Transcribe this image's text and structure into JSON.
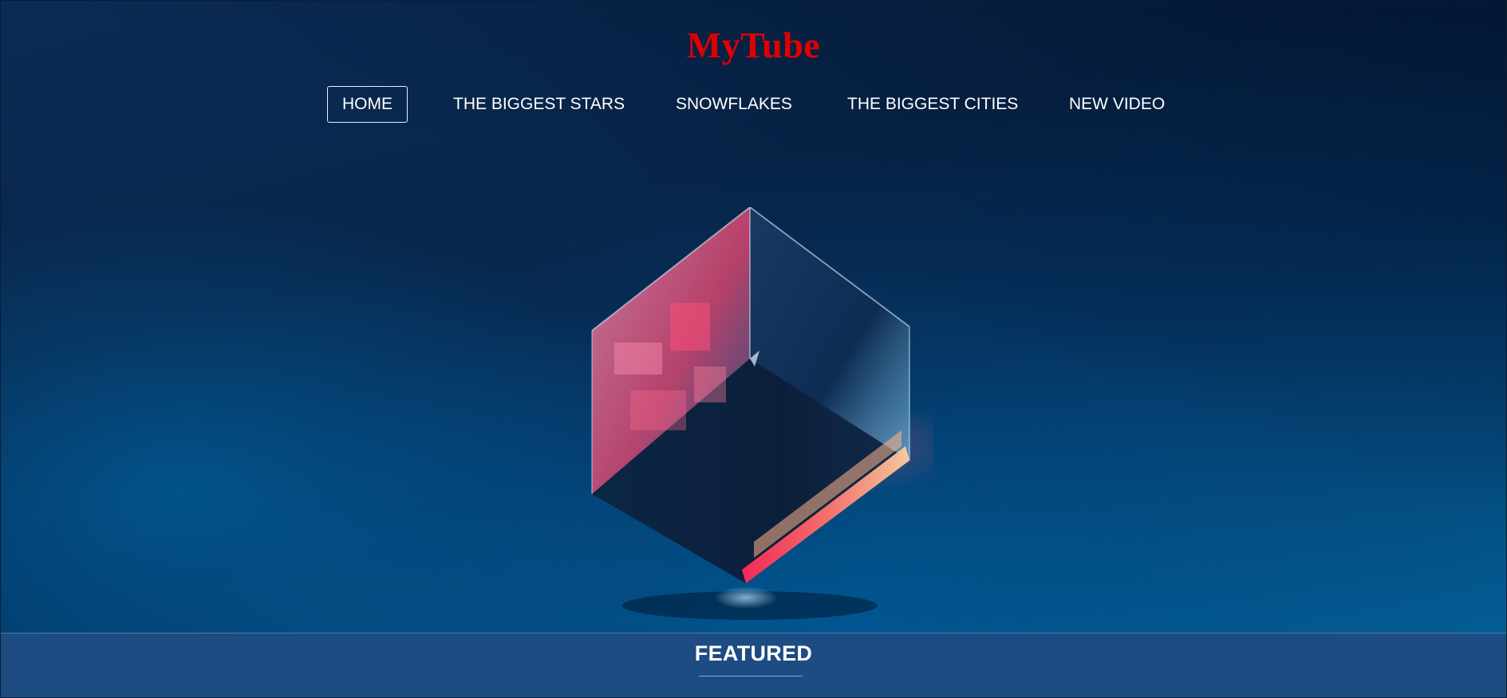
{
  "brand": {
    "name": "MyTube"
  },
  "nav": {
    "items": [
      {
        "label": "HOME",
        "active": true
      },
      {
        "label": "THE BIGGEST STARS",
        "active": false
      },
      {
        "label": "SNOWFLAKES",
        "active": false
      },
      {
        "label": "THE BIGGEST CITIES",
        "active": false
      },
      {
        "label": "NEW VIDEO",
        "active": false
      }
    ]
  },
  "hero": {
    "image": "glass-cube-illustration"
  },
  "featured": {
    "title": "FEATURED"
  },
  "colors": {
    "brand": "#e00000",
    "featured_bar": "#1c4c82",
    "hero_dark": "#08264b",
    "hero_light": "#035d95"
  }
}
